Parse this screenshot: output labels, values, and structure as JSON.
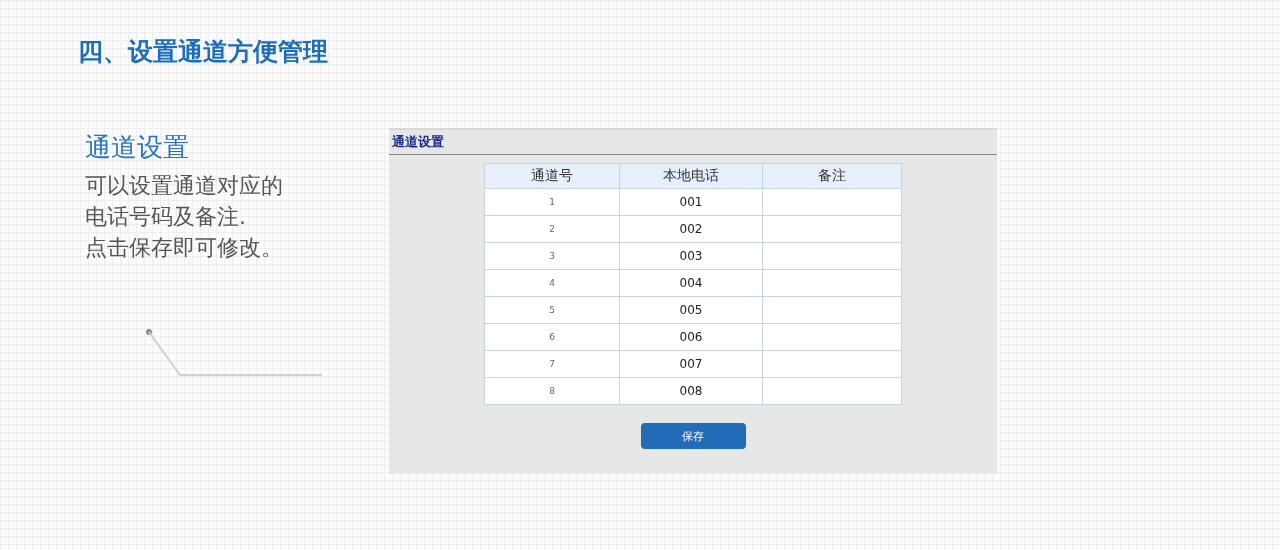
{
  "page_title": "四、设置通道方便管理",
  "section": {
    "title": "通道设置",
    "lines": [
      "可以设置通道对应的",
      "电话号码及备注.",
      "点击保存即可修改。"
    ]
  },
  "app": {
    "title": "通道设置",
    "table": {
      "columns": [
        "通道号",
        "本地电话",
        "备注"
      ],
      "rows": [
        {
          "channel": "1",
          "phone": "001"
        },
        {
          "channel": "2",
          "phone": "002"
        },
        {
          "channel": "3",
          "phone": "003"
        },
        {
          "channel": "4",
          "phone": "004"
        },
        {
          "channel": "5",
          "phone": "005"
        },
        {
          "channel": "6",
          "phone": "006"
        },
        {
          "channel": "7",
          "phone": "007"
        },
        {
          "channel": "8",
          "phone": "008"
        }
      ]
    },
    "save_button": "保存"
  }
}
